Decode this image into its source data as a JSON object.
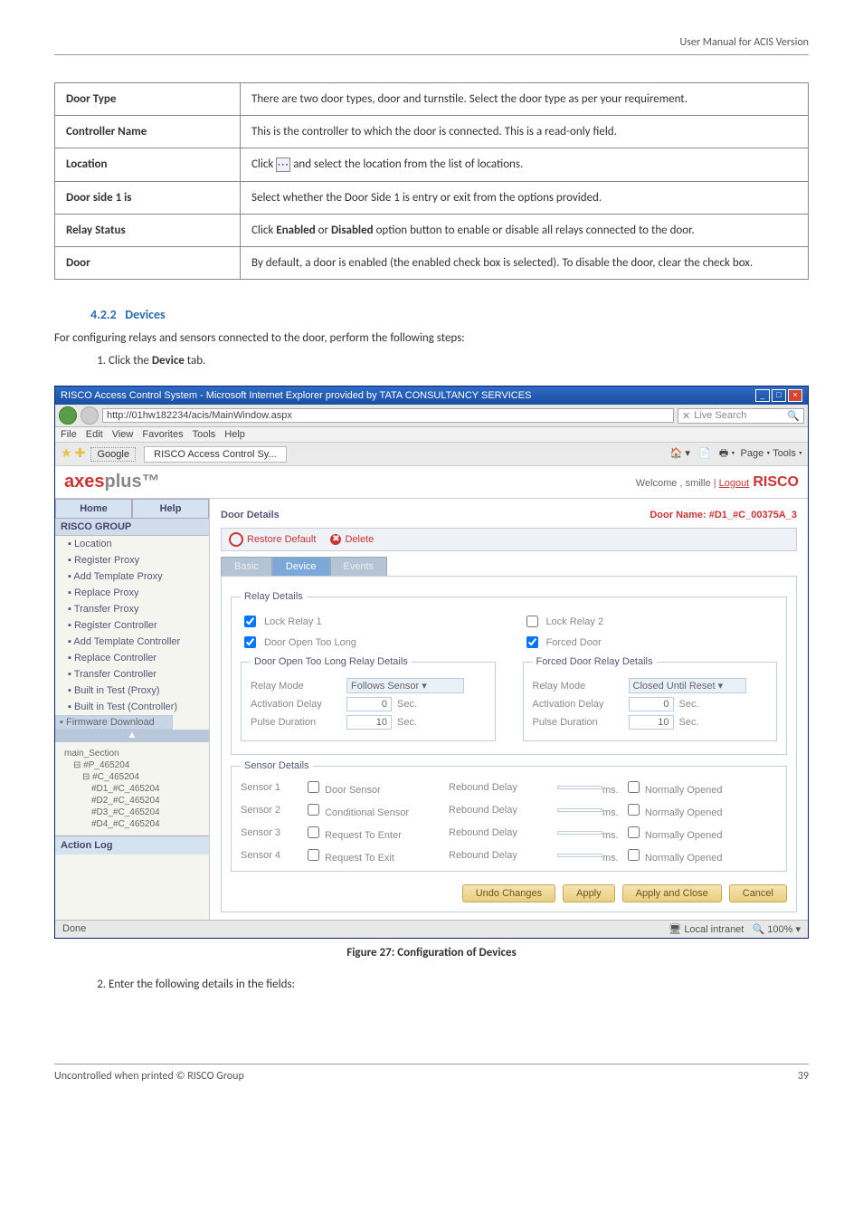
{
  "page_header": "User Manual for ACIS Version",
  "def_table": [
    {
      "label": "Door Type",
      "desc": "There are two door types, door and turnstile. Select the door type as per your requirement."
    },
    {
      "label": "Controller Name",
      "desc": "This is the controller to which the door is connected. This is a read-only field."
    },
    {
      "label": "Location",
      "desc_pre": "Click ",
      "desc_post": " and select the location from the list of locations."
    },
    {
      "label": "Door side 1 is",
      "desc": "Select whether the Door Side 1 is entry or exit from the options provided."
    },
    {
      "label": "Relay Status",
      "desc_pre": "Click ",
      "bold1": "Enabled",
      "mid": " or ",
      "bold2": "Disabled",
      "desc_post": " option button to enable or disable all relays connected to the door."
    },
    {
      "label": "Door",
      "desc": "By default, a door is enabled (the enabled check box is selected). To disable the door, clear the check box."
    }
  ],
  "section": {
    "num": "4.2.2",
    "title": "Devices"
  },
  "intro": "For configuring relays and sensors connected to the door, perform the following steps:",
  "step1_pre": "Click the ",
  "step1_bold": "Device",
  "step1_post": " tab.",
  "shot": {
    "title": "RISCO Access Control System - Microsoft Internet Explorer provided by TATA CONSULTANCY SERVICES",
    "addr": "http://01hw182234/acis/MainWindow.aspx",
    "search": "Live Search",
    "menus": [
      "File",
      "Edit",
      "View",
      "Favorites",
      "Tools",
      "Help"
    ],
    "fav_label": "Google",
    "tab": "RISCO Access Control Sy...",
    "toolbtns": "Page ▾   Tools ▾",
    "brand_a": "axes",
    "brand_rest": "plus™",
    "welcome_pre": "Welcome ,  smille  |  ",
    "welcome_logout": "Logout",
    "risco": "RISCO",
    "sb_tabs": [
      "Home",
      "Help"
    ],
    "sb_group": "RISCO GROUP",
    "sb_items": [
      "Location",
      "Register Proxy",
      "Add Template Proxy",
      "Replace Proxy",
      "Transfer Proxy",
      "Register Controller",
      "Add Template Controller",
      "Replace Controller",
      "Transfer Controller",
      "Built in Test (Proxy)",
      "Built in Test (Controller)",
      "Firmware Download"
    ],
    "tree_title": "main_Section",
    "tree": [
      "#P_465204",
      "#C_465204",
      "#D1_#C_465204",
      "#D2_#C_465204",
      "#D3_#C_465204",
      "#D4_#C_465204"
    ],
    "action_log": "Action Log",
    "panel_title": "Door Details",
    "door_name": "Door Name:  #D1_#C_00375A_3",
    "restore": "Restore Default",
    "delete": "Delete",
    "subtabs": [
      "Basic",
      "Device",
      "Events"
    ],
    "relay_legend": "Relay Details",
    "lock1": "Lock Relay 1",
    "lock2": "Lock Relay 2",
    "doolong": "Door Open Too Long",
    "forced": "Forced Door",
    "dootl_legend": "Door Open Too Long Relay Details",
    "fdrd_legend": "Forced Door Relay Details",
    "relay_mode": "Relay Mode",
    "follows": "Follows Sensor",
    "closed": "Closed Until Reset",
    "act_delay": "Activation Delay",
    "sec": "Sec.",
    "zero": "0",
    "pulse": "Pulse Duration",
    "ten": "10",
    "sensor_legend": "Sensor Details",
    "sensors": [
      "Sensor 1",
      "Sensor 2",
      "Sensor 3",
      "Sensor 4"
    ],
    "stypes": [
      "Door Sensor",
      "Conditional Sensor",
      "Request To Enter",
      "Request To Exit"
    ],
    "rebound": "Rebound Delay",
    "ms": "ms.",
    "normopen": "Normally Opened",
    "btns": [
      "Undo Changes",
      "Apply",
      "Apply and Close",
      "Cancel"
    ],
    "status_done": "Done",
    "status_zone": "Local intranet",
    "status_zoom": "100%"
  },
  "caption": "Figure 27: Configuration of Devices",
  "step2": "Enter the following details in the fields:",
  "footer_left": "Uncontrolled when printed © RISCO Group",
  "footer_right": "39"
}
